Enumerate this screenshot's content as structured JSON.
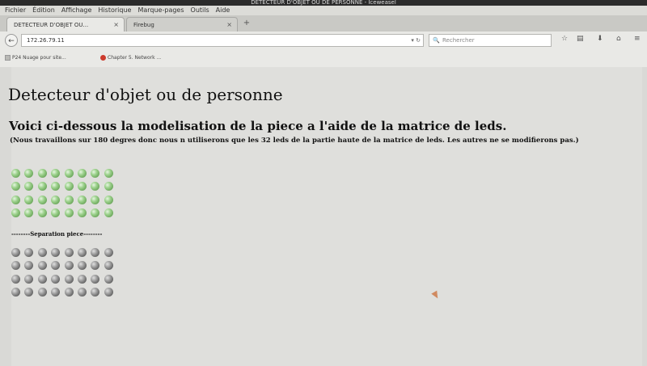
{
  "window": {
    "title": "DETECTEUR D'OBJET OU DE PERSONNE - Iceweasel"
  },
  "menu": [
    "Fichier",
    "Édition",
    "Affichage",
    "Historique",
    "Marque-pages",
    "Outils",
    "Aide"
  ],
  "tabs": [
    {
      "label": "DETECTEUR D'OBJET OU...",
      "close": "×"
    },
    {
      "label": "Firebug",
      "close": "×"
    }
  ],
  "newtab": "+",
  "nav": {
    "back": "←",
    "url": "172.26.79.11",
    "url_icons": "▾ ↻",
    "search_placeholder": "Rechercher",
    "search_glass": "🔍"
  },
  "bookmarks": [
    {
      "label": "P24 Nuage pour site...",
      "icon": "page-icon",
      "color": "#b9b9b5"
    },
    {
      "label": "Chapter 5. Network ...",
      "icon": "bookmark-favicon",
      "color": "#cc3b2d"
    }
  ],
  "page": {
    "h1": "Detecteur d'objet ou de personne",
    "h2": "Voici ci-dessous la modelisation de la piece a l'aide de la matrice de leds.",
    "note": "(Nous travaillons sur 180 degres donc nous n utiliserons que les 32 leds de la partie haute de la matrice de leds. Les autres ne se modifierons pas.)",
    "separator": "--------Separation piece--------"
  },
  "leds": {
    "top": {
      "rows": 4,
      "cols": 8,
      "state": "on",
      "color": "#4c8c3c"
    },
    "bottom": {
      "rows": 4,
      "cols": 8,
      "state": "off",
      "color": "#3c3c3c"
    }
  }
}
